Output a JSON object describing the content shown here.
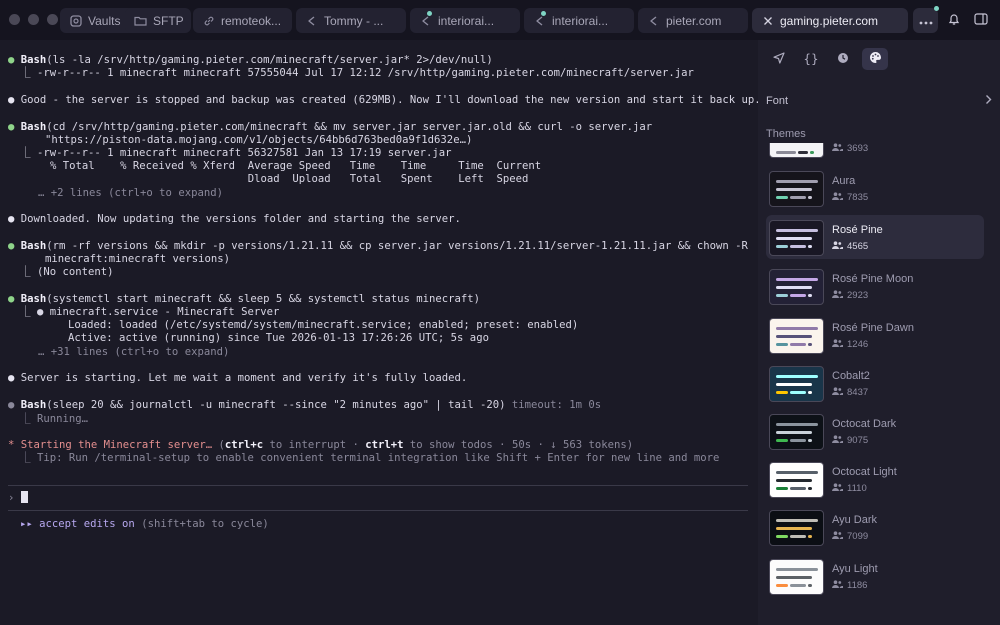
{
  "tabs": [
    {
      "label": "Vaults",
      "icon": "vault-icon",
      "active": false
    },
    {
      "label": "SFTP",
      "icon": "folder-icon",
      "active": false
    },
    {
      "label": "remoteok...",
      "icon": "link-icon",
      "active": false
    },
    {
      "label": "Tommy - ...",
      "icon": "terminal-arrow-icon",
      "active": false
    },
    {
      "label": "interiorai...",
      "icon": "terminal-arrow-icon",
      "active": false
    },
    {
      "label": "interiorai...",
      "icon": "terminal-arrow-icon",
      "active": false
    },
    {
      "label": "pieter.com",
      "icon": "terminal-arrow-icon",
      "active": false
    },
    {
      "label": "gaming.pieter.com",
      "icon": "close-icon",
      "active": true
    }
  ],
  "terminal": {
    "l1_label": "Bash",
    "l1_cmd": "(ls -la /srv/http/gaming.pieter.com/minecraft/server.jar* 2>/dev/null)",
    "l2": "⎿ -rw-r--r-- 1 minecraft minecraft 57555044 Jul 17 12:12 /srv/http/gaming.pieter.com/minecraft/server.jar",
    "l3": "Good - the server is stopped and backup was created (629MB). Now I'll download the new version and start it back up.",
    "l4_label": "Bash",
    "l4_cmd": "(cd /srv/http/gaming.pieter.com/minecraft && mv server.jar server.jar.old && curl -o server.jar",
    "l5": "\"https://piston-data.mojang.com/v1/objects/64bb6d763bed0a9f1d632e…)",
    "l6": "⎿ -rw-r--r-- 1 minecraft minecraft 56327581 Jan 13 17:19 server.jar",
    "l7": "% Total    % Received % Xferd  Average Speed   Time    Time     Time  Current",
    "l8": "                               Dload  Upload   Total   Spent    Left  Speed",
    "l9": "… +2 lines (ctrl+o to expand)",
    "l10": "Downloaded. Now updating the versions folder and starting the server.",
    "l11_label": "Bash",
    "l11_cmd": "(rm -rf versions && mkdir -p versions/1.21.11 && cp server.jar versions/1.21.11/server-1.21.11.jar && chown -R",
    "l12": "minecraft:minecraft versions)",
    "l13": "⎿ (No content)",
    "l14_label": "Bash",
    "l14_cmd": "(systemctl start minecraft && sleep 5 && systemctl status minecraft)",
    "l15": "⎿ ● minecraft.service - Minecraft Server",
    "l16": "Loaded: loaded (/etc/systemd/system/minecraft.service; enabled; preset: enabled)",
    "l17": "Active: active (running) since Tue 2026-01-13 17:26:26 UTC; 5s ago",
    "l18": "… +31 lines (ctrl+o to expand)",
    "l19": "Server is starting. Let me wait a moment and verify it's fully loaded.",
    "l20_label": "Bash",
    "l20_cmd": "(sleep 20 && journalctl -u minecraft --since \"2 minutes ago\" | tail -20)",
    "l20_timeout": "timeout: 1m 0s",
    "l21": "⎿ Running…",
    "l22_a": "* Starting the Minecraft server…",
    "l22_b": "(",
    "l22_c": "ctrl+c",
    "l22_d": " to interrupt · ",
    "l22_e": "ctrl+t",
    "l22_f": " to show todos · 50s · ↓ 563 tokens)",
    "l23": "⎿ Tip: Run /terminal-setup to enable convenient terminal integration like Shift + Enter for new line and more",
    "prompt": "›",
    "accept_a": "▸▸ accept edits on",
    "accept_b": " (shift+tab to cycle)"
  },
  "panel": {
    "font_label": "Font",
    "themes_label": "Themes",
    "themes": [
      {
        "name": "",
        "count": "3693",
        "bg": "#f4f4f6",
        "bars": [
          "#8a8a96",
          "#2e2e38",
          "#3a9a5a"
        ]
      },
      {
        "name": "Aura",
        "count": "7835",
        "bg": "#15141b",
        "bars": [
          "#a19fb0",
          "#c7c5d4",
          "#6fd0b0"
        ]
      },
      {
        "name": "Rosé Pine",
        "count": "4565",
        "bg": "#191724",
        "bars": [
          "#c6bfe0",
          "#e0def4",
          "#9ccfd8"
        ],
        "selected": true
      },
      {
        "name": "Rosé Pine Moon",
        "count": "2923",
        "bg": "#232136",
        "bars": [
          "#c4a7e7",
          "#e0def4",
          "#9ccfd8"
        ]
      },
      {
        "name": "Rosé Pine Dawn",
        "count": "1246",
        "bg": "#faf4ed",
        "bars": [
          "#907aa9",
          "#575279",
          "#56949f"
        ]
      },
      {
        "name": "Cobalt2",
        "count": "8437",
        "bg": "#193549",
        "bars": [
          "#9effff",
          "#ffffff",
          "#ffc600"
        ]
      },
      {
        "name": "Octocat Dark",
        "count": "9075",
        "bg": "#0d1117",
        "bars": [
          "#8b949e",
          "#c9d1d9",
          "#3fb950"
        ]
      },
      {
        "name": "Octocat Light",
        "count": "1110",
        "bg": "#ffffff",
        "bars": [
          "#57606a",
          "#24292f",
          "#1a7f37"
        ]
      },
      {
        "name": "Ayu Dark",
        "count": "7099",
        "bg": "#0b0e14",
        "bars": [
          "#bfbdb6",
          "#e6b450",
          "#7fd962"
        ]
      },
      {
        "name": "Ayu Light",
        "count": "1186",
        "bg": "#fcfcfc",
        "bars": [
          "#8a9199",
          "#5c6166",
          "#fa8d3e"
        ]
      }
    ]
  }
}
